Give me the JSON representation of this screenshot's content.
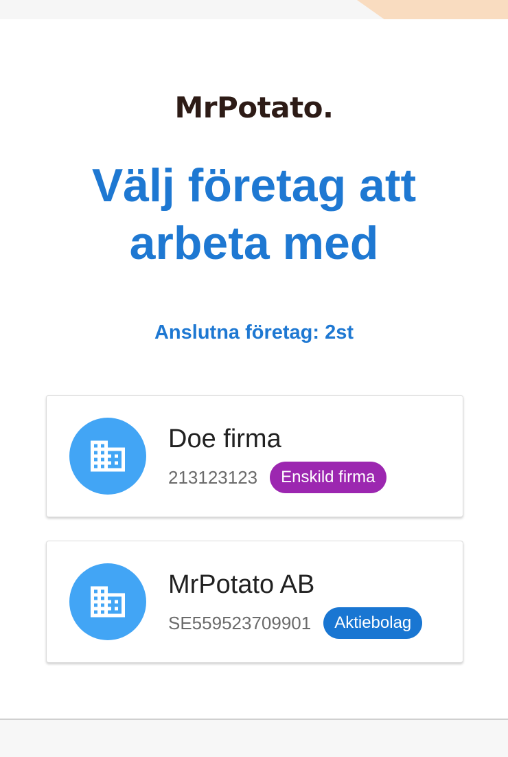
{
  "header": {
    "logo_text": "MrPotato."
  },
  "main": {
    "title": "Välj företag att arbeta med",
    "connected_label": "Anslutna företag: 2st"
  },
  "companies": [
    {
      "name": "Doe firma",
      "org_number": "213123123",
      "type": "Enskild firma",
      "type_color": "#9c27b0",
      "icon": "business-icon"
    },
    {
      "name": "MrPotato AB",
      "org_number": "SE559523709901",
      "type": "Aktiebolag",
      "type_color": "#1976d2",
      "icon": "business-icon"
    }
  ],
  "colors": {
    "primary": "#1e78d2",
    "avatar": "#42a5f5",
    "accent_top": "#f9dcc0"
  }
}
